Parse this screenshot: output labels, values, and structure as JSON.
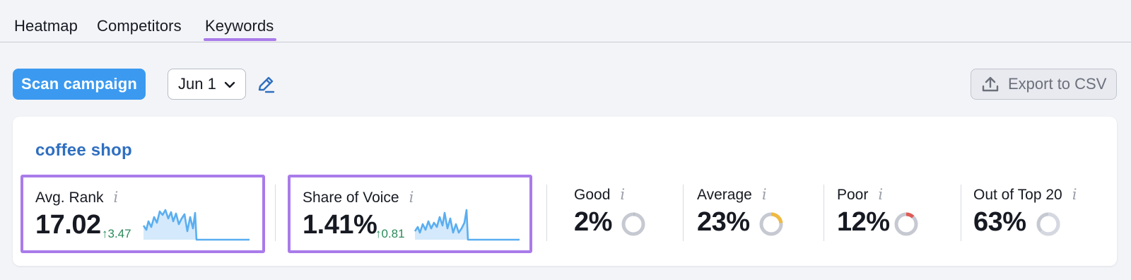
{
  "tabs": [
    {
      "label": "Heatmap",
      "active": false
    },
    {
      "label": "Competitors",
      "active": false
    },
    {
      "label": "Keywords",
      "active": true
    }
  ],
  "toolbar": {
    "scan_label": "Scan campaign",
    "date_value": "Jun 1",
    "export_label": "Export to CSV"
  },
  "keyword": "coffee shop",
  "metrics": {
    "avg_rank": {
      "label": "Avg. Rank",
      "value": "17.02",
      "delta": "3.47",
      "delta_arrow": "↑"
    },
    "share_of_voice": {
      "label": "Share of Voice",
      "value": "1.41%",
      "delta": "0.81",
      "delta_arrow": "↑"
    },
    "good": {
      "label": "Good",
      "value": "2%",
      "percent": 2,
      "color": "#b8bcc6"
    },
    "average": {
      "label": "Average",
      "value": "23%",
      "percent": 23,
      "color": "#f0b941"
    },
    "poor": {
      "label": "Poor",
      "value": "12%",
      "percent": 12,
      "color": "#e05a56"
    },
    "out_of_top_20": {
      "label": "Out of Top 20",
      "value": "63%",
      "percent": 63,
      "color": "#d5d8e0"
    }
  },
  "colors": {
    "accent": "#3b9af0",
    "highlight": "#a97bea",
    "keyword_title": "#2f6fc0",
    "delta_positive": "#2c8a5a",
    "sparkline": "#5aaef0"
  },
  "info_glyph": "i"
}
